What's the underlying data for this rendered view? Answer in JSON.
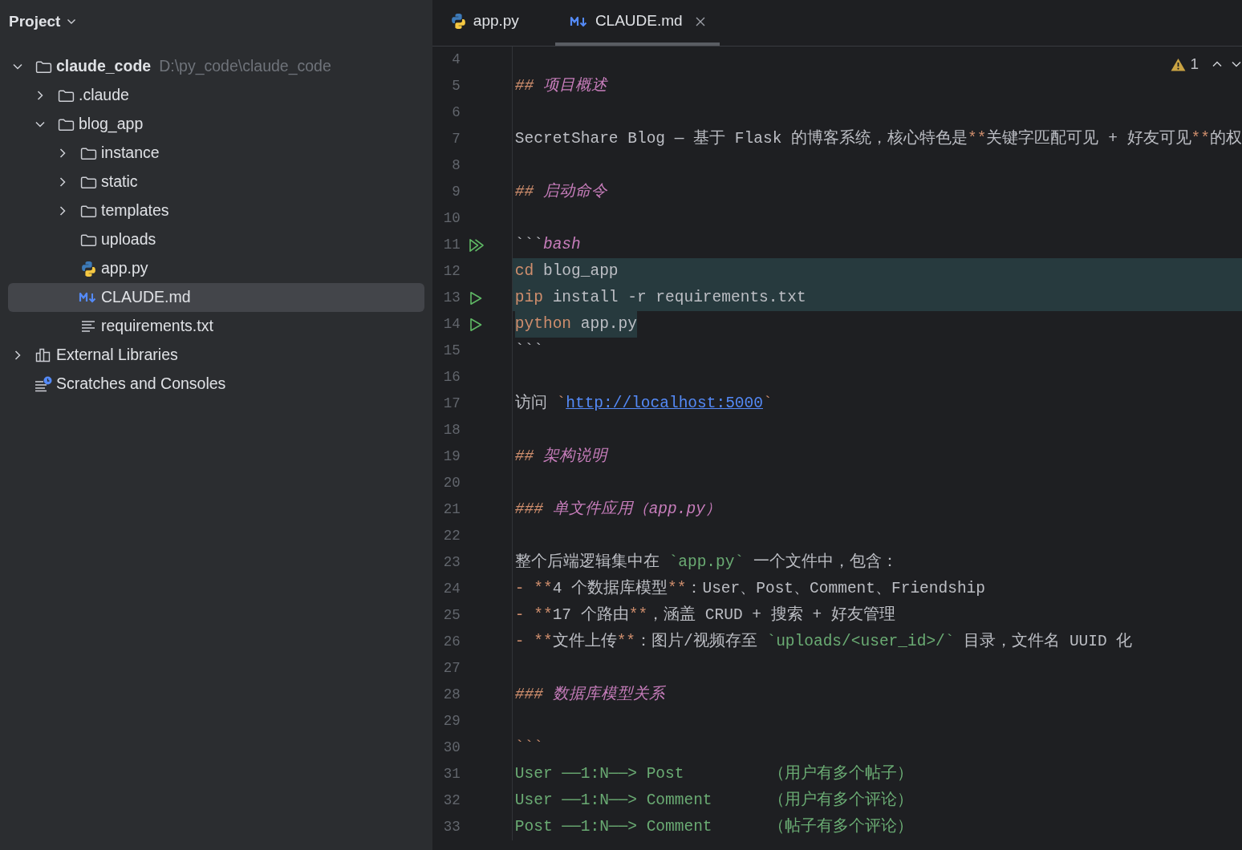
{
  "project_panel": {
    "title": "Project",
    "tree": [
      {
        "label": "claude_code",
        "path": "D:\\py_code\\claude_code",
        "kind": "folder",
        "expanded": true,
        "selected": false,
        "children": [
          {
            "label": ".claude",
            "kind": "folder",
            "expanded": false,
            "selected": false
          },
          {
            "label": "blog_app",
            "kind": "folder",
            "expanded": true,
            "selected": false,
            "children": [
              {
                "label": "instance",
                "kind": "folder",
                "expanded": false,
                "selected": false
              },
              {
                "label": "static",
                "kind": "folder",
                "expanded": false,
                "selected": false
              },
              {
                "label": "templates",
                "kind": "folder",
                "expanded": false,
                "selected": false
              },
              {
                "label": "uploads",
                "kind": "folder",
                "selected": false
              },
              {
                "label": "app.py",
                "kind": "python",
                "selected": false
              },
              {
                "label": "CLAUDE.md",
                "kind": "markdown",
                "selected": true
              },
              {
                "label": "requirements.txt",
                "kind": "text",
                "selected": false
              }
            ]
          }
        ]
      },
      {
        "label": "External Libraries",
        "kind": "libraries",
        "expanded": false,
        "selected": false
      },
      {
        "label": "Scratches and Consoles",
        "kind": "scratches",
        "selected": false
      }
    ]
  },
  "editor": {
    "tabs": [
      {
        "label": "app.py",
        "kind": "python",
        "selected": false,
        "closable": false
      },
      {
        "label": "CLAUDE.md",
        "kind": "markdown",
        "selected": true,
        "closable": true
      }
    ],
    "inspections": {
      "warnings": "1"
    },
    "lines": [
      {
        "number": "4"
      },
      {
        "number": "5",
        "tokens": [
          {
            "kind": "heading_mark",
            "text": "## "
          },
          {
            "kind": "heading",
            "text": "项目概述"
          }
        ]
      },
      {
        "number": "6"
      },
      {
        "number": "7",
        "tokens": [
          {
            "kind": "text",
            "text": "SecretShare Blog — 基于 Flask 的博客系统，核心特色是"
          },
          {
            "kind": "bold_mark",
            "text": "**"
          },
          {
            "kind": "text",
            "text": "关键字匹配可见 + 好友可见"
          },
          {
            "kind": "bold_mark",
            "text": "**"
          },
          {
            "kind": "text",
            "text": "的权"
          }
        ]
      },
      {
        "number": "8"
      },
      {
        "number": "9",
        "tokens": [
          {
            "kind": "heading_mark",
            "text": "## "
          },
          {
            "kind": "heading",
            "text": "启动命令"
          }
        ]
      },
      {
        "number": "10"
      },
      {
        "number": "11",
        "gutter": {
          "kind": "run_all"
        },
        "tokens": [
          {
            "kind": "fence",
            "text": "```"
          },
          {
            "kind": "lang",
            "text": "bash"
          }
        ]
      },
      {
        "number": "12",
        "selected": true,
        "whole_line": true,
        "tokens": [
          {
            "kind": "keyword",
            "text": "cd"
          },
          {
            "kind": "text",
            "text": " blog_app"
          }
        ]
      },
      {
        "number": "13",
        "selected": true,
        "whole_line": true,
        "gutter": {
          "kind": "run"
        },
        "tokens": [
          {
            "kind": "keyword",
            "text": "pip"
          },
          {
            "kind": "text",
            "text": " install -r requirements.txt"
          }
        ]
      },
      {
        "number": "14",
        "selected": true,
        "whole_line": false,
        "gutter": {
          "kind": "run"
        },
        "tokens": [
          {
            "kind": "keyword",
            "text": "python"
          },
          {
            "kind": "text",
            "text": " app.py"
          }
        ]
      },
      {
        "number": "15",
        "tokens": [
          {
            "kind": "fence",
            "text": "```"
          }
        ]
      },
      {
        "number": "16"
      },
      {
        "number": "17",
        "tokens": [
          {
            "kind": "text",
            "text": "访问 "
          },
          {
            "kind": "tick",
            "text": "`"
          },
          {
            "kind": "link",
            "text": "http://localhost:5000"
          },
          {
            "kind": "tick",
            "text": "`"
          }
        ]
      },
      {
        "number": "18"
      },
      {
        "number": "19",
        "tokens": [
          {
            "kind": "heading_mark",
            "text": "## "
          },
          {
            "kind": "heading",
            "text": "架构说明"
          }
        ]
      },
      {
        "number": "20"
      },
      {
        "number": "21",
        "tokens": [
          {
            "kind": "heading_mark",
            "text": "### "
          },
          {
            "kind": "heading",
            "text": "单文件应用（app.py）"
          }
        ]
      },
      {
        "number": "22"
      },
      {
        "number": "23",
        "tokens": [
          {
            "kind": "text",
            "text": "整个后端逻辑集中在 "
          },
          {
            "kind": "code",
            "text": "`app.py`"
          },
          {
            "kind": "text",
            "text": " 一个文件中，包含："
          }
        ]
      },
      {
        "number": "24",
        "tokens": [
          {
            "kind": "list_mark",
            "text": "- "
          },
          {
            "kind": "bold_mark",
            "text": "**"
          },
          {
            "kind": "text",
            "text": "4 个数据库模型"
          },
          {
            "kind": "bold_mark",
            "text": "**"
          },
          {
            "kind": "text",
            "text": "：User、Post、Comment、Friendship"
          }
        ]
      },
      {
        "number": "25",
        "tokens": [
          {
            "kind": "list_mark",
            "text": "- "
          },
          {
            "kind": "bold_mark",
            "text": "**"
          },
          {
            "kind": "text",
            "text": "17 个路由"
          },
          {
            "kind": "bold_mark",
            "text": "**"
          },
          {
            "kind": "text",
            "text": "，涵盖 CRUD + 搜索 + 好友管理"
          }
        ]
      },
      {
        "number": "26",
        "tokens": [
          {
            "kind": "list_mark",
            "text": "- "
          },
          {
            "kind": "bold_mark",
            "text": "**"
          },
          {
            "kind": "text",
            "text": "文件上传"
          },
          {
            "kind": "bold_mark",
            "text": "**"
          },
          {
            "kind": "text",
            "text": "：图片/视频存至 "
          },
          {
            "kind": "code",
            "text": "`uploads/<user_id>/`"
          },
          {
            "kind": "text",
            "text": " 目录，文件名 UUID 化"
          }
        ]
      },
      {
        "number": "27"
      },
      {
        "number": "28",
        "tokens": [
          {
            "kind": "heading_mark",
            "text": "### "
          },
          {
            "kind": "heading",
            "text": "数据库模型关系"
          }
        ]
      },
      {
        "number": "29"
      },
      {
        "number": "30",
        "tokens": [
          {
            "kind": "tick",
            "text": "```"
          }
        ]
      },
      {
        "number": "31",
        "tokens": [
          {
            "kind": "block",
            "text": "User ──1:N──> Post         （用户有多个帖子）"
          }
        ]
      },
      {
        "number": "32",
        "tokens": [
          {
            "kind": "block",
            "text": "User ──1:N──> Comment      （用户有多个评论）"
          }
        ]
      },
      {
        "number": "33",
        "tokens": [
          {
            "kind": "block",
            "text": "Post ──1:N──> Comment      （帖子有多个评论）"
          }
        ]
      }
    ]
  }
}
